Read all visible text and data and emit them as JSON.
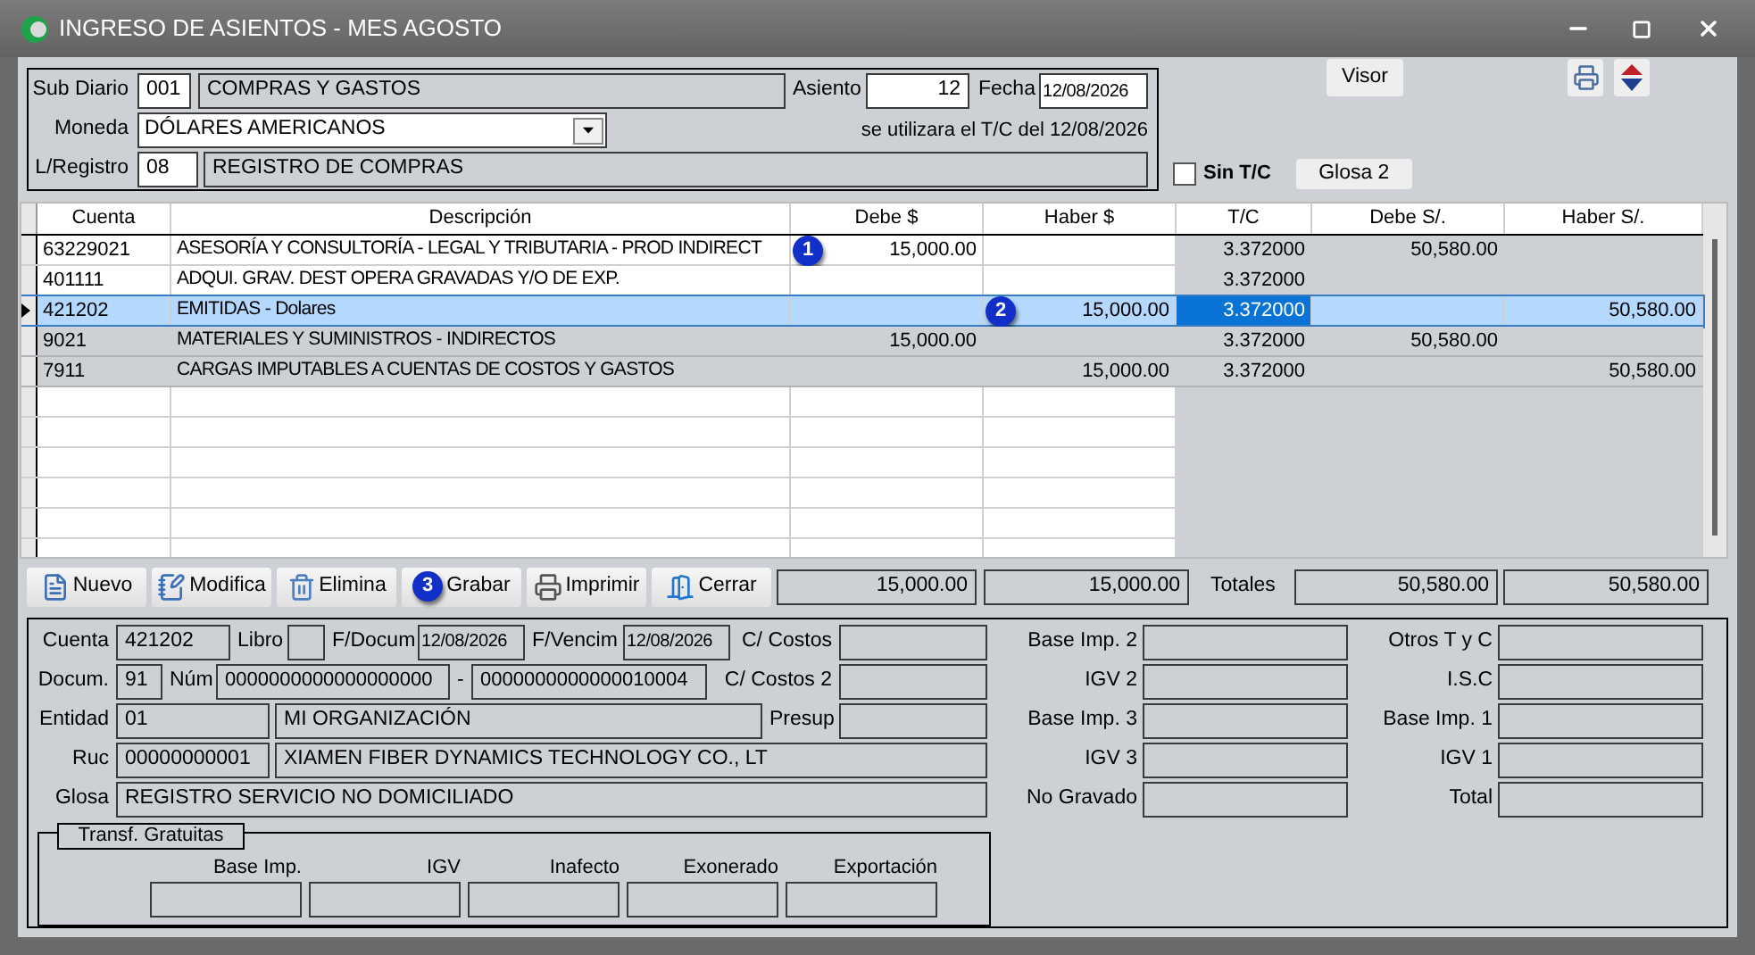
{
  "window": {
    "title": "INGRESO DE ASIENTOS - MES AGOSTO"
  },
  "header": {
    "sub_diario": {
      "label": "Sub Diario",
      "code": "001",
      "name": "COMPRAS Y GASTOS"
    },
    "asiento": {
      "label": "Asiento",
      "value": "12"
    },
    "fecha": {
      "label": "Fecha",
      "value": "12/08/2026"
    },
    "moneda": {
      "label": "Moneda",
      "value": "DÓLARES AMERICANOS"
    },
    "tc_note": "se utilizara el T/C del 12/08/2026",
    "registro": {
      "label": "L/Registro",
      "code": "08",
      "name": "REGISTRO DE COMPRAS"
    }
  },
  "side": {
    "visor": "Visor",
    "sin_tc": {
      "label": "Sin T/C",
      "checked": false
    },
    "glosa2": "Glosa 2"
  },
  "table": {
    "columns": [
      "Cuenta",
      "Descripción",
      "Debe $",
      "Haber $",
      "T/C",
      "Debe S/.",
      "Haber S/."
    ],
    "rows": [
      {
        "selected": false,
        "shaded": false,
        "cuenta": "63229021",
        "descripcion": "ASESORÍA Y CONSULTORÍA - LEGAL Y TRIBUTARIA - PROD INDIRECT",
        "debe_usd": "15,000.00",
        "tc": "3.372000",
        "debe_pen": "50,580.00",
        "callout": "1"
      },
      {
        "selected": false,
        "shaded": false,
        "cuenta": "401111",
        "descripcion": "ADQUI. GRAV. DEST OPERA GRAVADAS Y/O DE EXP.",
        "tc": "3.372000"
      },
      {
        "selected": true,
        "cuenta": "421202",
        "descripcion": "EMITIDAS - Dolares",
        "haber_usd": "15,000.00",
        "tc": "3.372000",
        "haber_pen": "50,580.00",
        "callout": "2"
      },
      {
        "selected": false,
        "shaded": true,
        "cuenta": "9021",
        "descripcion": "MATERIALES Y SUMINISTROS - INDIRECTOS",
        "debe_usd": "15,000.00",
        "tc": "3.372000",
        "debe_pen": "50,580.00"
      },
      {
        "selected": false,
        "shaded": true,
        "cuenta": "7911",
        "descripcion": "CARGAS IMPUTABLES A CUENTAS DE COSTOS Y GASTOS",
        "haber_usd": "15,000.00",
        "tc": "3.372000",
        "haber_pen": "50,580.00"
      }
    ]
  },
  "buttons": [
    {
      "kind": "new",
      "label": "Nuevo"
    },
    {
      "kind": "edit",
      "label": "Modifica"
    },
    {
      "kind": "delete",
      "label": "Elimina"
    },
    {
      "label": "Grabar",
      "callout": "3"
    },
    {
      "kind": "print",
      "label": "Imprimir"
    },
    {
      "kind": "close",
      "label": "Cerrar"
    }
  ],
  "totals": {
    "debe_usd": "15,000.00",
    "haber_usd": "15,000.00",
    "label": "Totales",
    "debe_pen": "50,580.00",
    "haber_pen": "50,580.00"
  },
  "detail": {
    "cuenta": {
      "label": "Cuenta",
      "value": "421202"
    },
    "libro": {
      "label": "Libro"
    },
    "f_docum": {
      "label": "F/Docum",
      "value": "12/08/2026"
    },
    "f_vencim": {
      "label": "F/Vencim",
      "value": "12/08/2026"
    },
    "c_costos": {
      "label": "C/ Costos"
    },
    "docum": {
      "label": "Docum.",
      "value": "91"
    },
    "num": {
      "label": "Núm",
      "serie": "0000000000000000000",
      "separator": "-",
      "numero": "0000000000000010004"
    },
    "c_costos2": {
      "label": "C/ Costos 2"
    },
    "entidad": {
      "label": "Entidad",
      "code": "01",
      "name": "MI ORGANIZACIÓN"
    },
    "presup": {
      "label": "Presup"
    },
    "ruc": {
      "label": "Ruc",
      "code": "00000000001",
      "name": "XIAMEN FIBER DYNAMICS TECHNOLOGY CO., LT"
    },
    "glosa": {
      "label": "Glosa",
      "value": "REGISTRO SERVICIO NO DOMICILIADO"
    },
    "middle": [
      {
        "label": "Base Imp. 2"
      },
      {
        "label": "IGV 2"
      },
      {
        "label": "Base Imp. 3"
      },
      {
        "label": "IGV 3"
      },
      {
        "label": "No Gravado"
      }
    ],
    "right": [
      {
        "label": "Otros T y C"
      },
      {
        "label": "I.S.C"
      },
      {
        "label": "Base Imp. 1"
      },
      {
        "label": "IGV 1"
      },
      {
        "label": "Total"
      }
    ],
    "transf": {
      "title": "Transf. Gratuitas",
      "columns": [
        {
          "label": "Base Imp."
        },
        {
          "label": "IGV"
        },
        {
          "label": "Inafecto"
        },
        {
          "label": "Exonerado"
        },
        {
          "label": "Exportación"
        }
      ]
    }
  }
}
